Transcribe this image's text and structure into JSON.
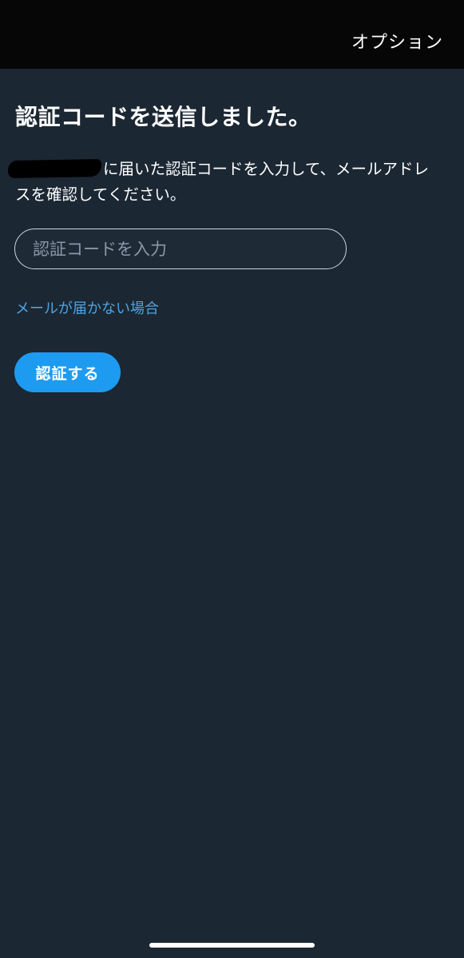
{
  "header": {
    "options_label": "オプション"
  },
  "main": {
    "title": "認証コードを送信しました。",
    "description_line1": "に届いた認証コードを入力して、メールアドレ",
    "description_line2": "スを確認してください。",
    "code_input": {
      "value": "",
      "placeholder": "認証コードを入力"
    },
    "help_link_label": "メールが届かない場合",
    "verify_button_label": "認証する"
  },
  "colors": {
    "background": "#1b2733",
    "top_bar": "#060606",
    "accent": "#1d9bf0",
    "link": "#4fa3e0"
  }
}
